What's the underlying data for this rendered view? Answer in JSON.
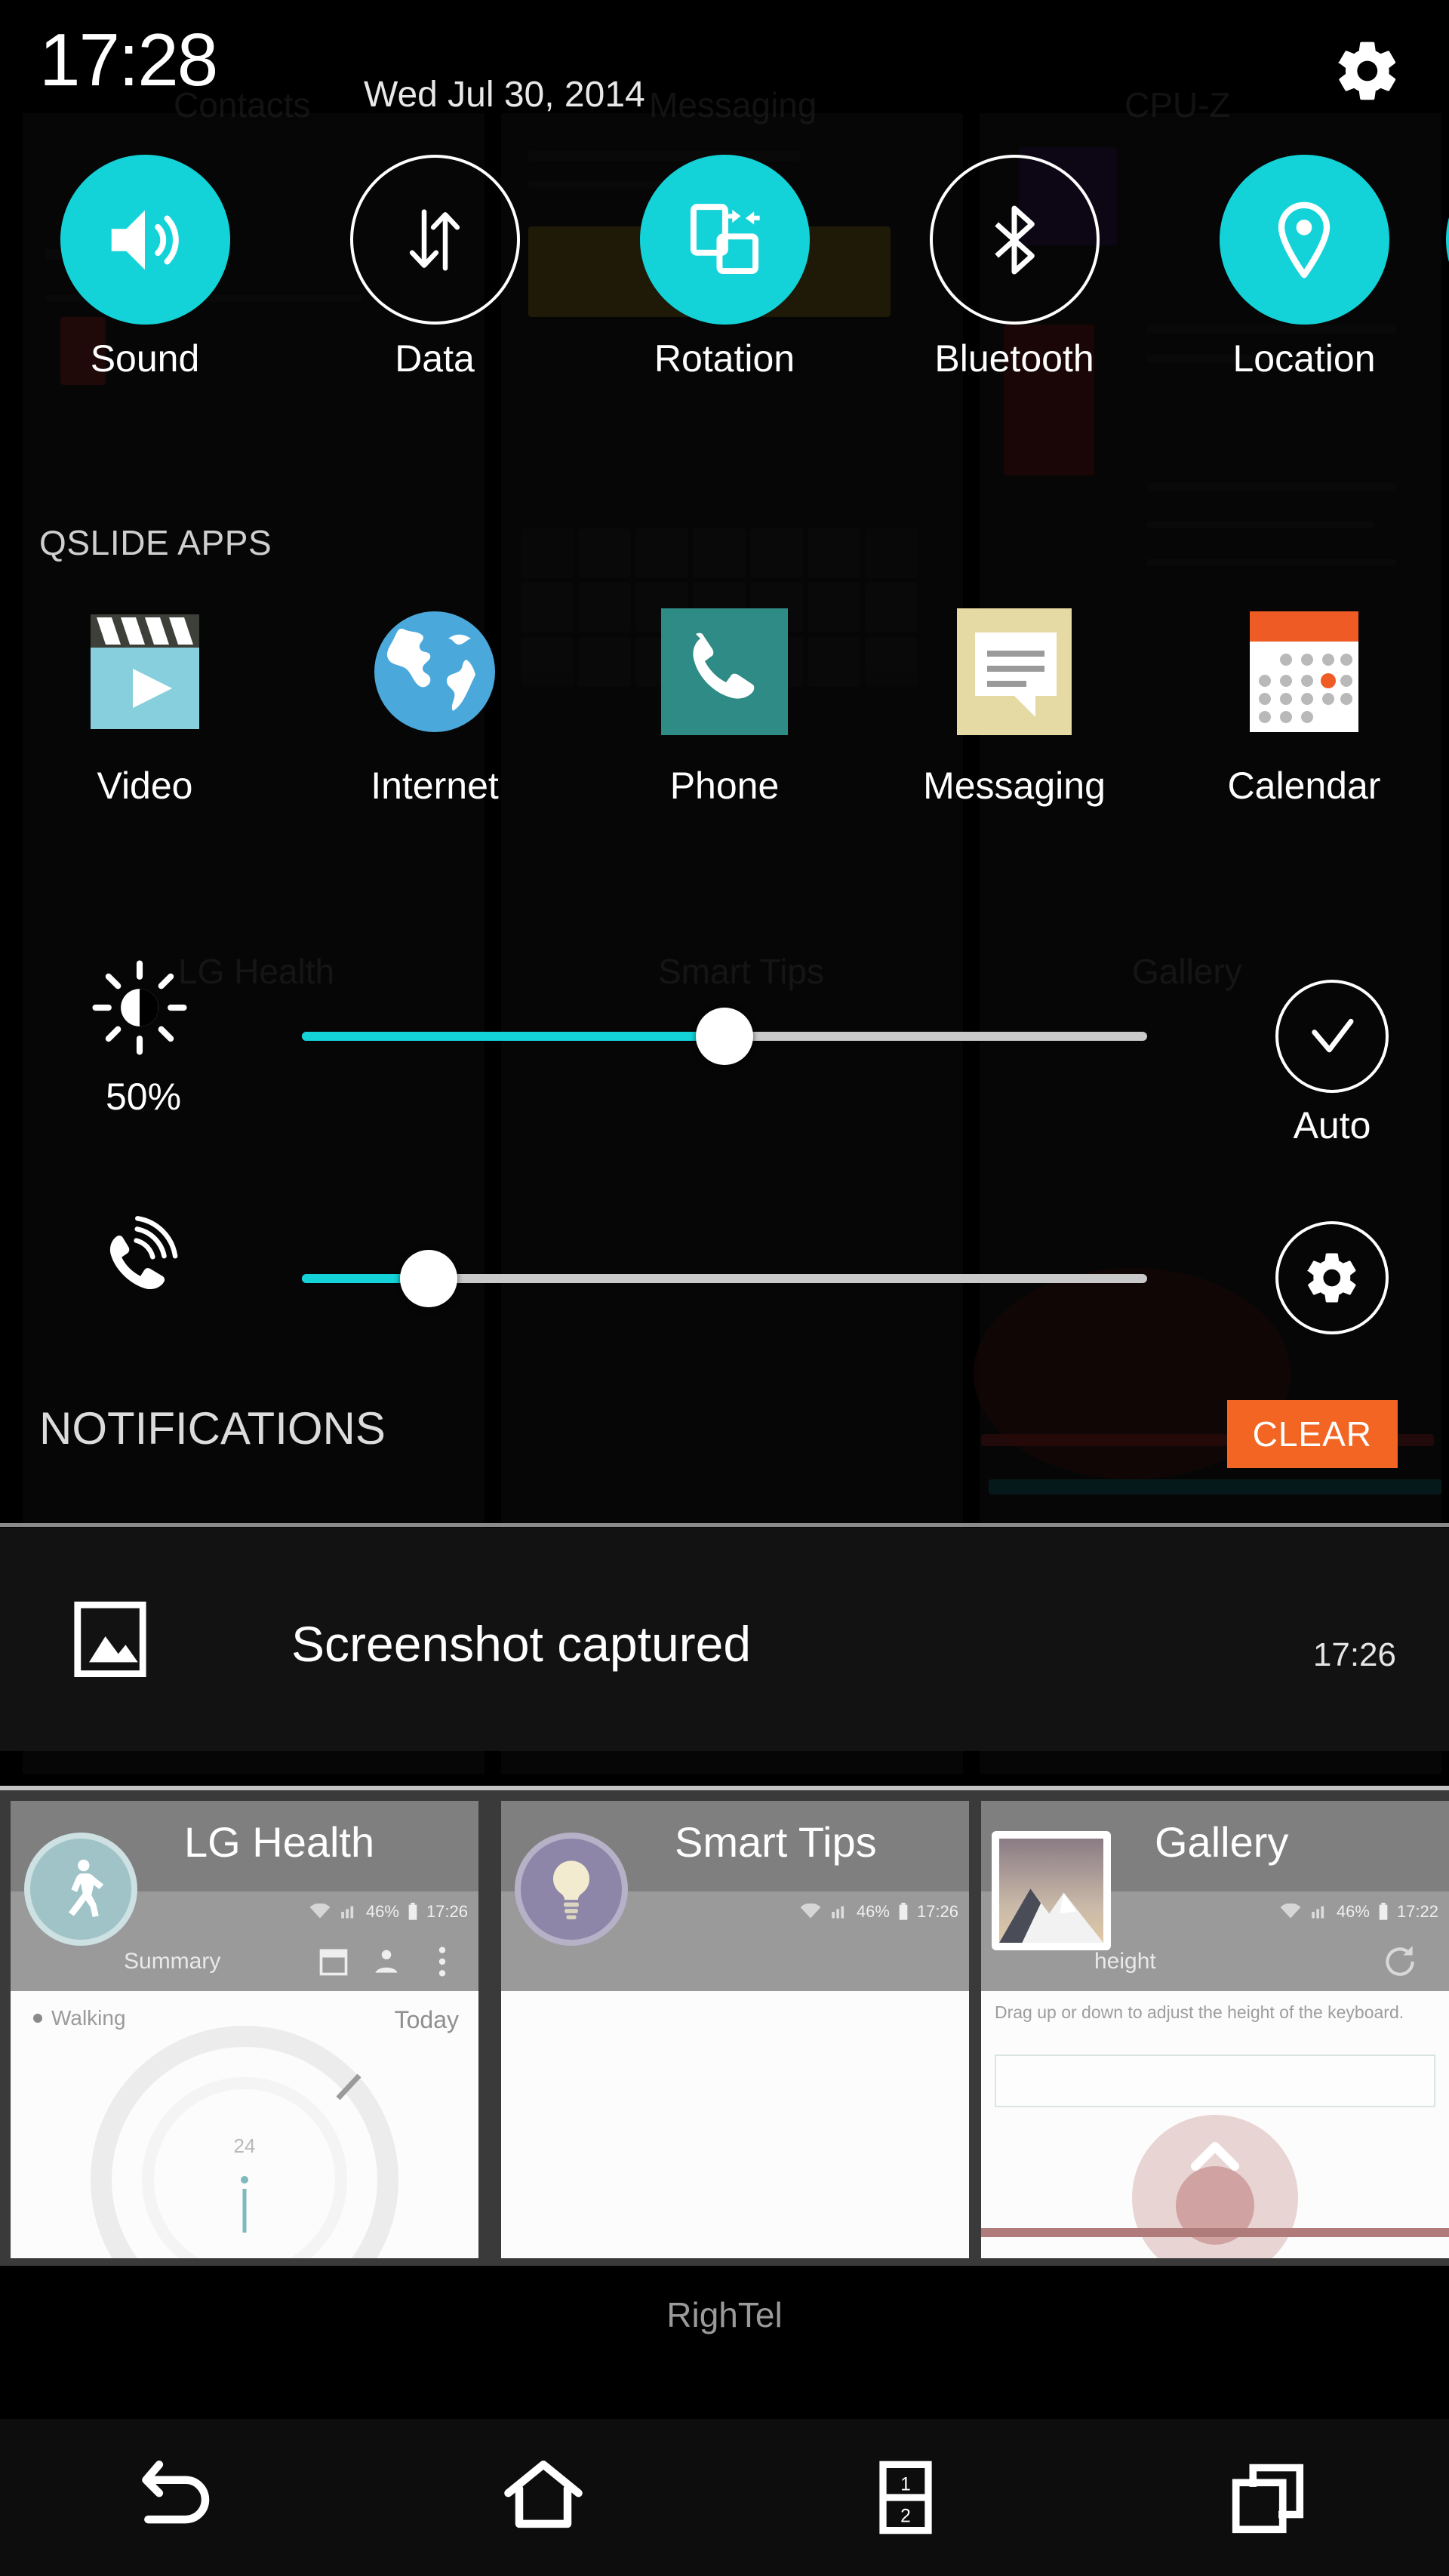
{
  "statusbar": {
    "time": "17:28",
    "date": "Wed Jul 30, 2014",
    "settings_icon": "gear-icon"
  },
  "quick_toggles": {
    "items": [
      {
        "label": "Sound",
        "icon": "volume-speaker-icon",
        "state": "on"
      },
      {
        "label": "Data",
        "icon": "data-transfer-arrows-icon",
        "state": "off"
      },
      {
        "label": "Rotation",
        "icon": "screen-rotation-icon",
        "state": "on"
      },
      {
        "label": "Bluetooth",
        "icon": "bluetooth-icon",
        "state": "off"
      },
      {
        "label": "Location",
        "icon": "location-pin-icon",
        "state": "on"
      },
      {
        "label": "",
        "icon": "more-toggle-icon",
        "state": "on"
      }
    ]
  },
  "qslide": {
    "header": "QSLIDE APPS",
    "apps": [
      {
        "label": "Video",
        "icon": "video-clapperboard-icon",
        "color": "#87cfdd"
      },
      {
        "label": "Internet",
        "icon": "globe-icon",
        "color": "#4aa8db"
      },
      {
        "label": "Phone",
        "icon": "phone-handset-icon",
        "color": "#2e8b86"
      },
      {
        "label": "Messaging",
        "icon": "speech-bubble-icon",
        "color": "#e5d9a4"
      },
      {
        "label": "Calendar",
        "icon": "calendar-icon",
        "color": "#ef5b25"
      }
    ]
  },
  "brightness": {
    "icon": "brightness-sun-icon",
    "value_label": "50%",
    "percent": 50,
    "auto_label": "Auto",
    "auto_icon": "check-circle-icon",
    "fill_color": "#14d3d8"
  },
  "volume": {
    "icon": "ringer-volume-icon",
    "percent": 15,
    "settings_icon": "gear-circle-icon",
    "fill_color": "#14d3d8"
  },
  "notifications": {
    "header": "NOTIFICATIONS",
    "clear_label": "CLEAR",
    "clear_color": "#f26522",
    "items": [
      {
        "icon": "image-picture-icon",
        "title": "Screenshot captured",
        "time": "17:26"
      }
    ]
  },
  "recent_apps": [
    {
      "title": "LG Health",
      "badge_icon": "walking-person-icon",
      "badge_color": "#9fc3c6",
      "status": "17:26",
      "battery": "46%",
      "subtitle": "Summary",
      "body_left": "Walking",
      "body_right": "Today",
      "gauge_value": "24"
    },
    {
      "title": "Smart Tips",
      "badge_icon": "lightbulb-icon",
      "badge_color": "#8d86a8",
      "status": "17:26",
      "battery": "46%",
      "subtitle": "",
      "body_left": "",
      "body_right": "",
      "gauge_value": ""
    },
    {
      "title": "Gallery",
      "badge_icon": "mountain-photo-icon",
      "badge_color": "#ffffff",
      "status": "17:22",
      "battery": "46%",
      "subtitle": "height",
      "body_left": "Drag up or down to adjust the height of the keyboard.",
      "body_right": "",
      "gauge_value": ""
    }
  ],
  "carrier": {
    "name": "RighTel"
  },
  "navbar": {
    "buttons": [
      {
        "name": "back",
        "icon": "back-arrow-icon"
      },
      {
        "name": "home",
        "icon": "home-house-icon"
      },
      {
        "name": "dual-window",
        "icon": "dual-window-icon",
        "top": "1",
        "bottom": "2"
      },
      {
        "name": "recents",
        "icon": "recent-apps-icon"
      }
    ]
  },
  "background_apps": {
    "labels": [
      "Contacts",
      "Messaging",
      "CPU-Z",
      "LG Health",
      "Smart Tips",
      "Gallery"
    ]
  },
  "theme": {
    "accent": "#14d3d8",
    "orange": "#f26522",
    "panel": "#121212"
  }
}
